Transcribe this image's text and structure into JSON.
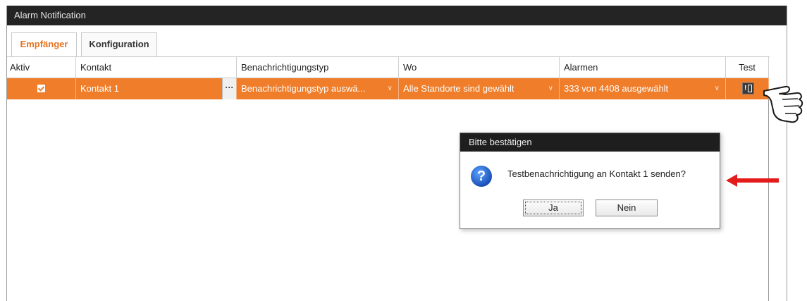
{
  "window": {
    "title": "Alarm Notification"
  },
  "tabs": [
    {
      "label": "Empfänger",
      "active": true
    },
    {
      "label": "Konfiguration",
      "active": false
    }
  ],
  "table": {
    "headers": [
      "Aktiv",
      "Kontakt",
      "Benachrichtigungstyp",
      "Wo",
      "Alarmen",
      "Test"
    ],
    "rows": [
      {
        "aktiv": true,
        "kontakt": "Kontakt 1",
        "benachrichtigungstyp": "Benachrichtigungstyp auswä...",
        "wo": "Alle Standorte sind gewählt",
        "alarmen": "333 von 4408 ausgewählt"
      }
    ]
  },
  "dialog": {
    "title": "Bitte bestätigen",
    "message": "Testbenachrichtigung an Kontakt 1 senden?",
    "yes_label": "Ja",
    "no_label": "Nein"
  },
  "colors": {
    "accent": "#ef7d2a",
    "titlebar": "#242424",
    "arrow": "#e31b1b"
  },
  "icons": {
    "dialog": "question-icon",
    "test": "test-notification-icon",
    "row_menu": "ellipsis-icon",
    "dropdown": "chevron-down-icon"
  }
}
